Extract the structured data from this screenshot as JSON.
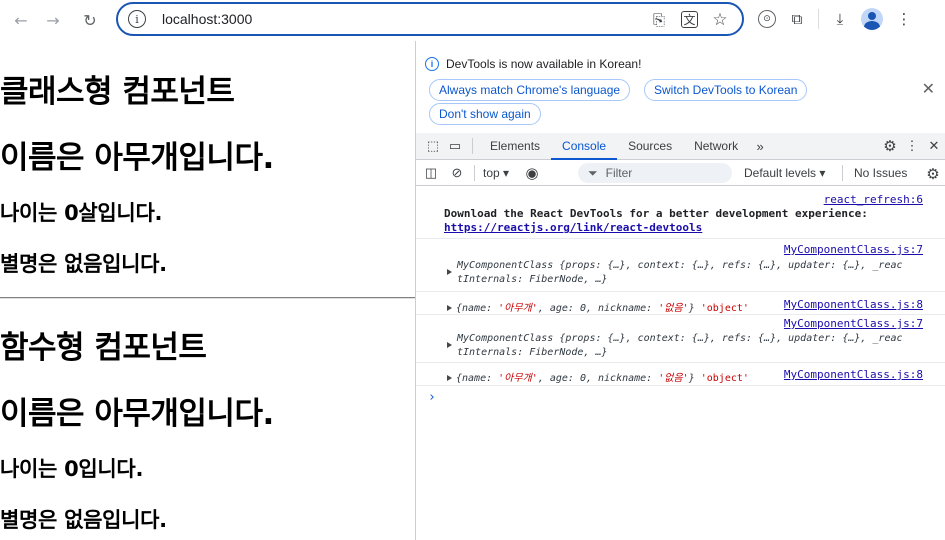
{
  "browser": {
    "url": "localhost:3000"
  },
  "page": {
    "class_section": {
      "heading": "클래스형 컴포넌트",
      "name_line": "이름은 아무개입니다.",
      "age_line": "나이는 0살입니다.",
      "nickname_line": "별명은 없음입니다."
    },
    "func_section": {
      "heading": "함수형 컴포넌트",
      "name_line": "이름은 아무개입니다.",
      "age_line": "나이는 0입니다.",
      "nickname_line": "별명은 없음입니다."
    }
  },
  "devtools": {
    "banner": {
      "message": "DevTools is now available in Korean!",
      "btn_match": "Always match Chrome's language",
      "btn_switch": "Switch DevTools to Korean",
      "btn_dont_show": "Don't show again"
    },
    "tabs": [
      "Elements",
      "Console",
      "Sources",
      "Network"
    ],
    "active_tab": "Console",
    "console_toolbar": {
      "context": "top",
      "filter_placeholder": "Filter",
      "levels": "Default levels",
      "issues": "No Issues"
    },
    "messages": {
      "m1": {
        "source": "react_refresh:6",
        "text": "Download the React DevTools for a better development experience:",
        "link": "https://reactjs.org/link/react-devtools"
      },
      "m2": {
        "source": "MyComponentClass.js:7",
        "line1": "MyComponentClass {props: {…}, context: {…}, refs: {…}, updater: {…}, _reac",
        "line2": "tInternals: FiberNode, …}"
      },
      "m3": {
        "source": "MyComponentClass.js:8",
        "prefix": "{name: ",
        "name_val": "'아무개'",
        "mid": ", age: 0, nickname: ",
        "nick_val": "'없음'",
        "suffix": "} ",
        "type": "'object'"
      },
      "m4": {
        "source": "MyComponentClass.js:7",
        "line1": "MyComponentClass {props: {…}, context: {…}, refs: {…}, updater: {…}, _reac",
        "line2": "tInternals: FiberNode, …}"
      },
      "m5": {
        "source": "MyComponentClass.js:8",
        "prefix": "{name: ",
        "name_val": "'아무개'",
        "mid": ", age: 0, nickname: ",
        "nick_val": "'없음'",
        "suffix": "} ",
        "type": "'object'"
      }
    },
    "prompt": "›"
  },
  "icons": {
    "back": "←",
    "forward": "→",
    "reload": "↻",
    "install": "⎘",
    "translate": "文",
    "star": "☆",
    "extensions": "⧉",
    "download": "⤓",
    "close": "✕",
    "more": "⋮",
    "gear": "⚙",
    "chevrons": "»"
  },
  "colors": {
    "accent": "#0b57d0",
    "omnibox_border": "#1a56b4",
    "link": "#1a0dab",
    "string": "#c80000"
  }
}
